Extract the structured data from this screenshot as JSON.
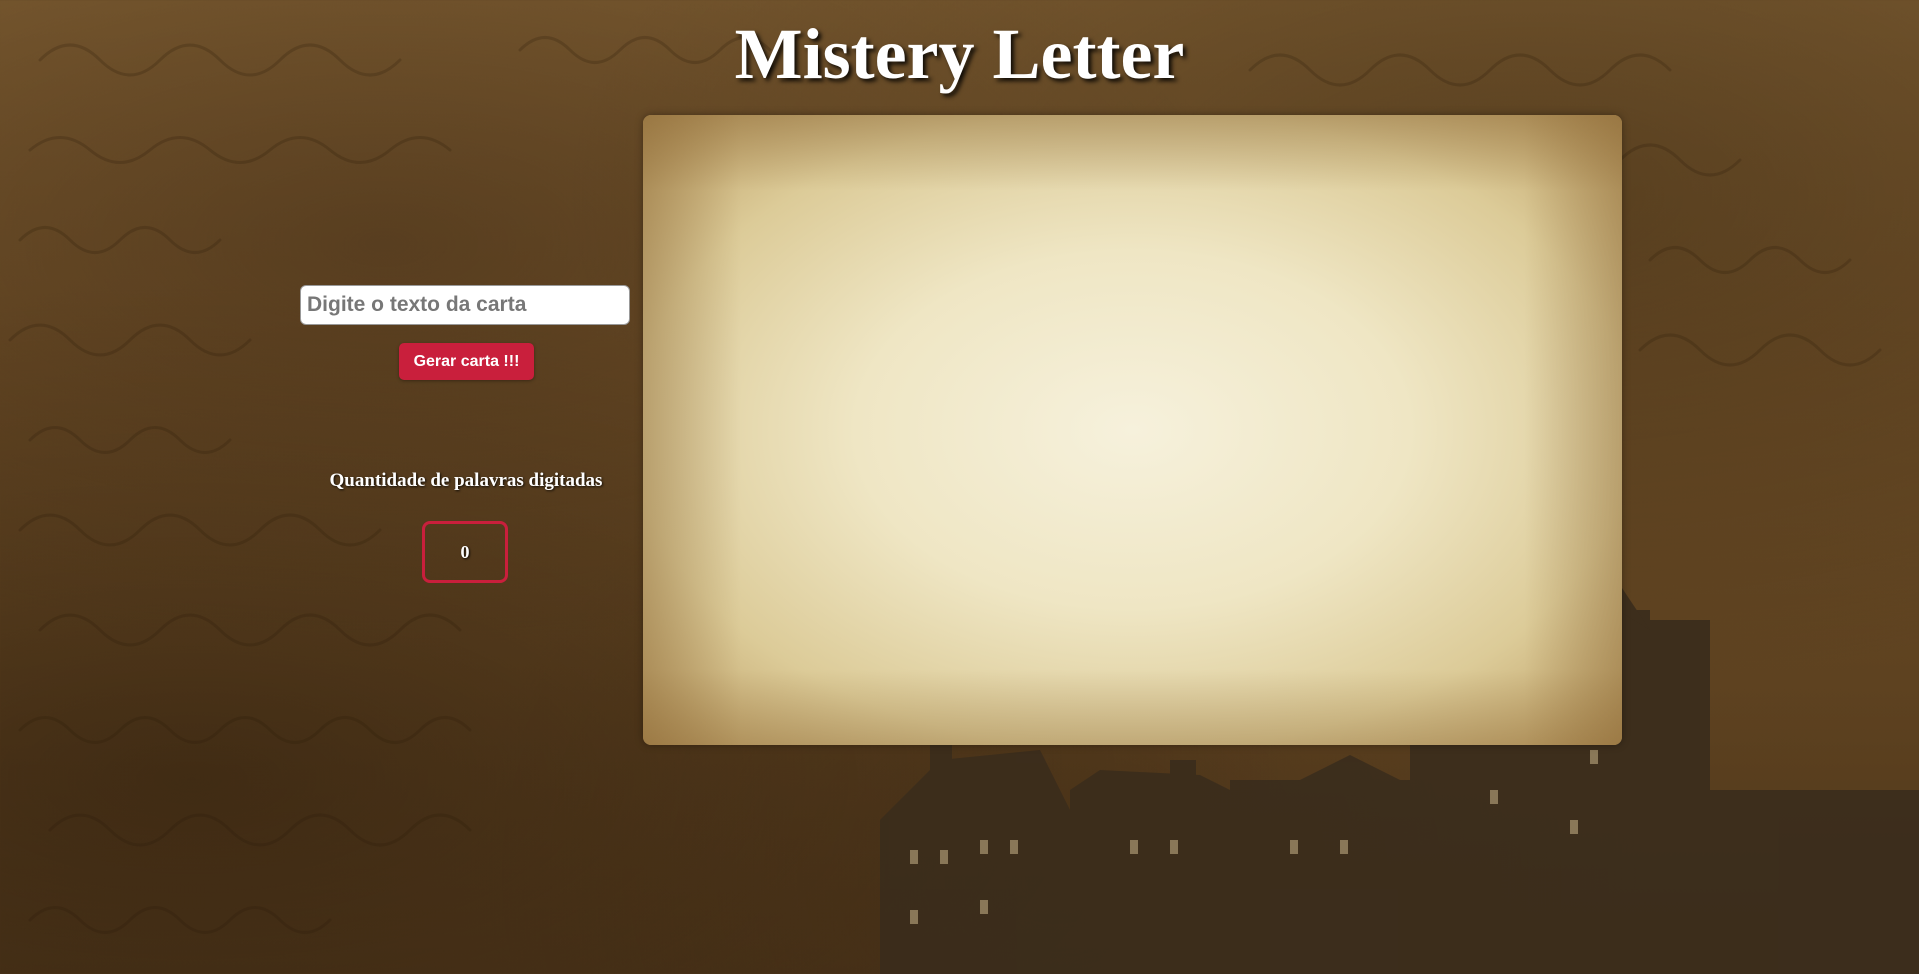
{
  "header": {
    "title": "Mistery Letter"
  },
  "form": {
    "input_value": "",
    "input_placeholder": "Digite o texto da carta",
    "generate_label": "Gerar carta !!!"
  },
  "counter": {
    "label": "Quantidade de palavras digitadas",
    "value": "0"
  },
  "letter": {
    "content": ""
  },
  "colors": {
    "accent": "#c91f3c",
    "title_text": "#ffffff",
    "paper": "#f6f1dc"
  }
}
